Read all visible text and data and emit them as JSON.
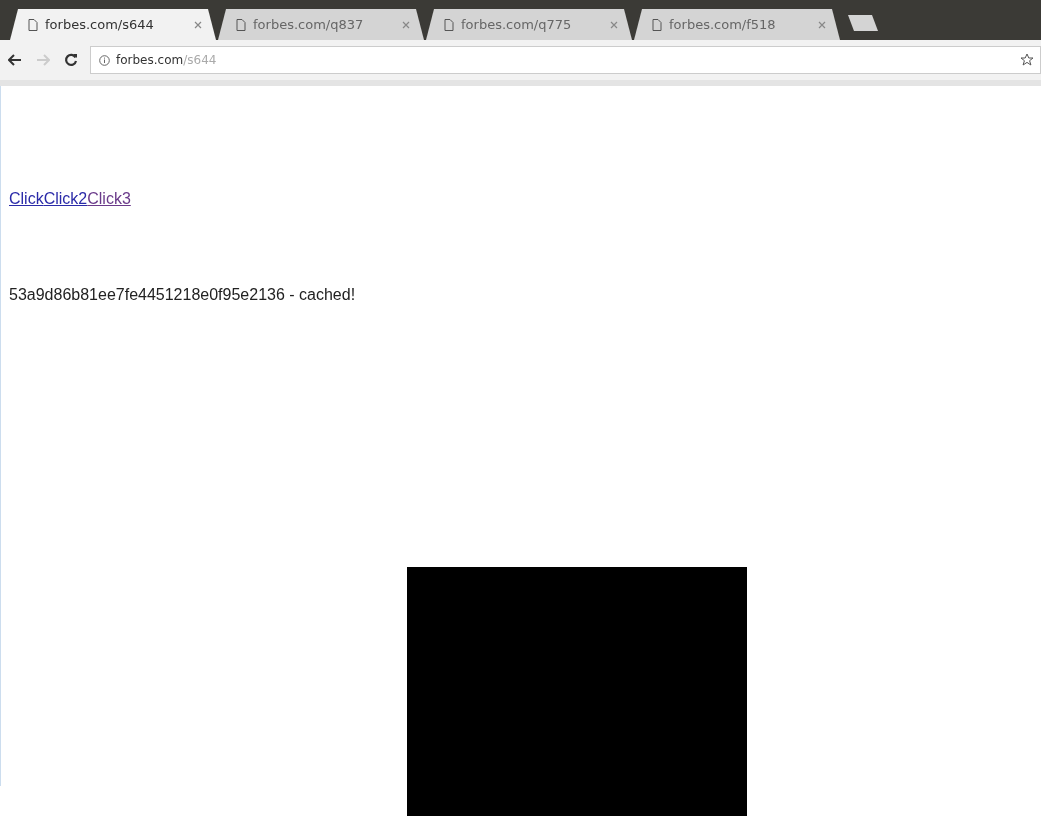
{
  "tabs": [
    {
      "title": "forbes.com/s644",
      "selected": true
    },
    {
      "title": "forbes.com/q837",
      "selected": false
    },
    {
      "title": "forbes.com/q775",
      "selected": false
    },
    {
      "title": "forbes.com/f518",
      "selected": false
    }
  ],
  "address_bar": {
    "domain": "forbes.com",
    "path": "/s644"
  },
  "links": [
    {
      "label": "Click",
      "visited": false
    },
    {
      "label": "Click2",
      "visited": false
    },
    {
      "label": "Click3",
      "visited": true
    }
  ],
  "message": "53a9d86b81ee7fe4451218e0f95e2136 - cached!"
}
